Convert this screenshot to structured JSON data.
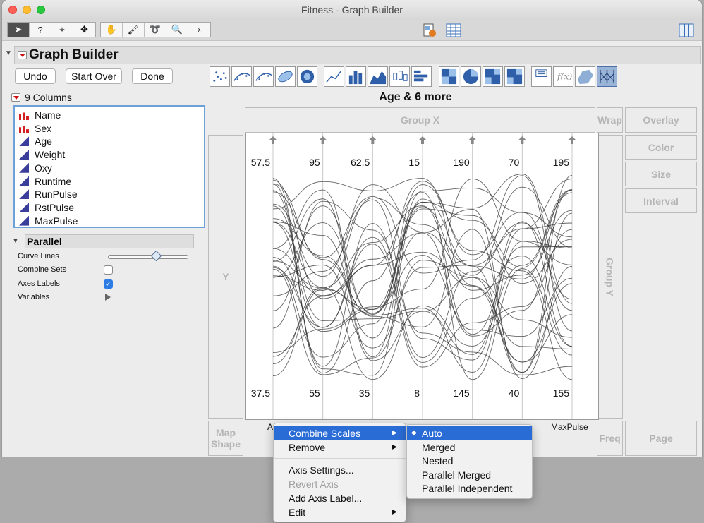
{
  "window": {
    "title": "Fitness - Graph Builder"
  },
  "toolbar": {
    "tools": [
      {
        "icon": "arrow-pointer-icon",
        "glyph": "➤",
        "active": true
      },
      {
        "icon": "help-question-icon",
        "glyph": "?"
      },
      {
        "icon": "crosshair-icon",
        "glyph": "⌖"
      },
      {
        "icon": "move-grabber-icon",
        "glyph": "✥"
      }
    ],
    "tools2": [
      {
        "icon": "hand-icon",
        "glyph": "✋"
      },
      {
        "icon": "brush-icon",
        "glyph": "🖌"
      },
      {
        "icon": "lasso-icon",
        "glyph": "➰"
      },
      {
        "icon": "magnifier-icon",
        "glyph": "🔍"
      },
      {
        "icon": "annotate-icon",
        "glyph": "ᵡ"
      }
    ]
  },
  "graph_builder": {
    "title": "Graph Builder",
    "buttons": {
      "undo": "Undo",
      "start_over": "Start Over",
      "done": "Done"
    },
    "columns_label": "9 Columns",
    "columns": [
      {
        "name": "Name",
        "type": "nominal"
      },
      {
        "name": "Sex",
        "type": "nominal"
      },
      {
        "name": "Age",
        "type": "continuous"
      },
      {
        "name": "Weight",
        "type": "continuous"
      },
      {
        "name": "Oxy",
        "type": "continuous"
      },
      {
        "name": "Runtime",
        "type": "continuous"
      },
      {
        "name": "RunPulse",
        "type": "continuous"
      },
      {
        "name": "RstPulse",
        "type": "continuous"
      },
      {
        "name": "MaxPulse",
        "type": "continuous"
      }
    ],
    "parallel": {
      "header": "Parallel",
      "options": {
        "curve_lines": "Curve Lines",
        "combine_sets": "Combine Sets",
        "axes_labels": "Axes Labels",
        "variables": "Variables"
      },
      "curve_lines_level": 0.6,
      "combine_sets_checked": false,
      "axes_labels_checked": true
    },
    "graph_title": "Age & 6 more",
    "zones": {
      "group_x": "Group X",
      "wrap": "Wrap",
      "overlay": "Overlay",
      "color": "Color",
      "size": "Size",
      "interval": "Interval",
      "y": "Y",
      "group_y": "Group Y",
      "map_shape": "Map Shape",
      "freq": "Freq",
      "page": "Page"
    }
  },
  "chart_data": {
    "type": "parallel",
    "axes": [
      {
        "name": "Age",
        "label": "Ag",
        "top": "57.5",
        "bottom": "37.5"
      },
      {
        "name": "Weight",
        "label": "",
        "top": "95",
        "bottom": "55"
      },
      {
        "name": "Oxy",
        "label": "",
        "top": "62.5",
        "bottom": "35"
      },
      {
        "name": "Runtime",
        "label": "",
        "top": "15",
        "bottom": "8"
      },
      {
        "name": "RunPulse",
        "label": "",
        "top": "190",
        "bottom": "145"
      },
      {
        "name": "RstPulse",
        "label": "e",
        "top": "70",
        "bottom": "40"
      },
      {
        "name": "MaxPulse",
        "label": "MaxPulse",
        "top": "195",
        "bottom": "155"
      }
    ],
    "line_count": 31,
    "curve_lines": true
  },
  "context_menu": {
    "items": [
      {
        "label": "Combine Scales",
        "submenu": true,
        "highlighted": true
      },
      {
        "label": "Remove",
        "submenu": true
      },
      {
        "separator": true
      },
      {
        "label": "Axis Settings..."
      },
      {
        "label": "Revert Axis",
        "disabled": true
      },
      {
        "label": "Add Axis Label..."
      },
      {
        "label": "Edit",
        "submenu": true
      }
    ],
    "submenu": [
      {
        "label": "Auto",
        "selected": true
      },
      {
        "label": "Merged"
      },
      {
        "label": "Nested"
      },
      {
        "label": "Parallel Merged"
      },
      {
        "label": "Parallel Independent"
      }
    ]
  }
}
